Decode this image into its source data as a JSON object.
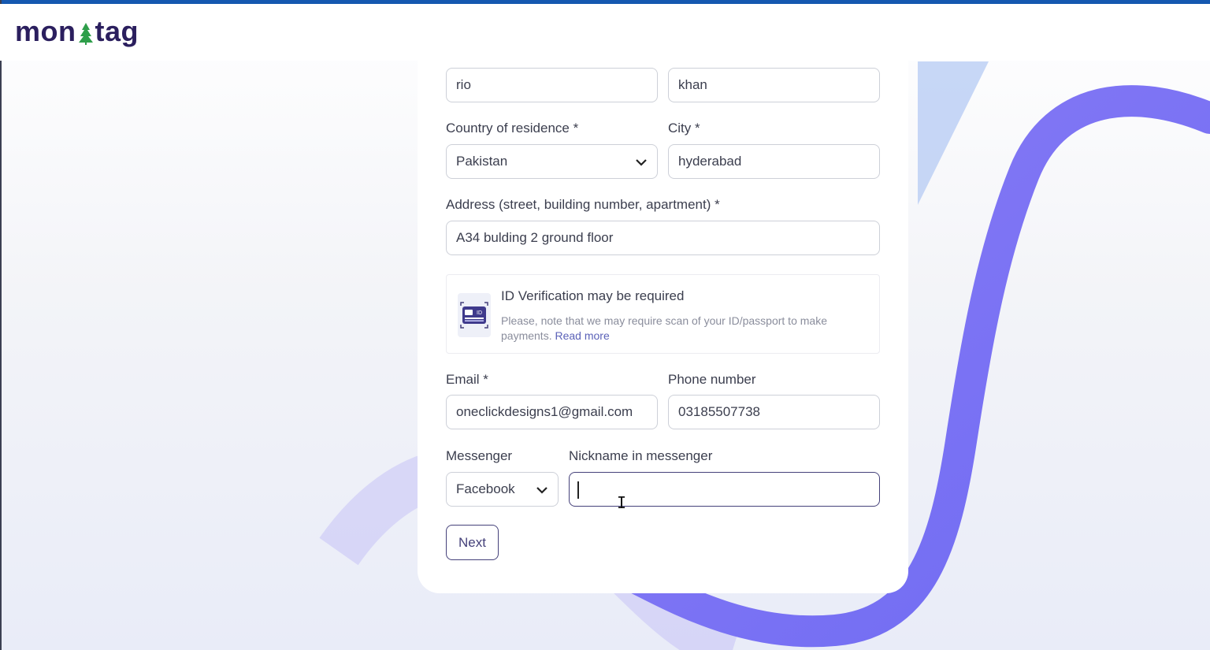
{
  "brand": {
    "logo_left": "mon",
    "logo_right": "tag",
    "tree_color": "#2e9e4a",
    "text_color": "#2b1f5e"
  },
  "form": {
    "first_name": {
      "value": "rio"
    },
    "last_name": {
      "value": "khan"
    },
    "country": {
      "label": "Country of residence *",
      "value": "Pakistan"
    },
    "city": {
      "label": "City *",
      "value": "hyderabad"
    },
    "address": {
      "label": "Address (street, building number, apartment) *",
      "value": "A34 bulding 2 ground floor"
    },
    "id_notice": {
      "title": "ID Verification may be required",
      "text": "Please, note that we may require scan of your ID/passport to make payments.",
      "link": "Read more",
      "icon": "id-card-icon"
    },
    "email": {
      "label": "Email *",
      "value": "oneclickdesigns1@gmail.com"
    },
    "phone": {
      "label": "Phone number",
      "value": "03185507738"
    },
    "messenger": {
      "label": "Messenger",
      "value": "Facebook"
    },
    "nickname": {
      "label": "Nickname in messenger",
      "value": ""
    },
    "next_label": "Next"
  },
  "colors": {
    "accent": "#45417a",
    "link": "#5b62b8",
    "wave": "#7b6cf0",
    "top_stripe": "#1558b0"
  }
}
